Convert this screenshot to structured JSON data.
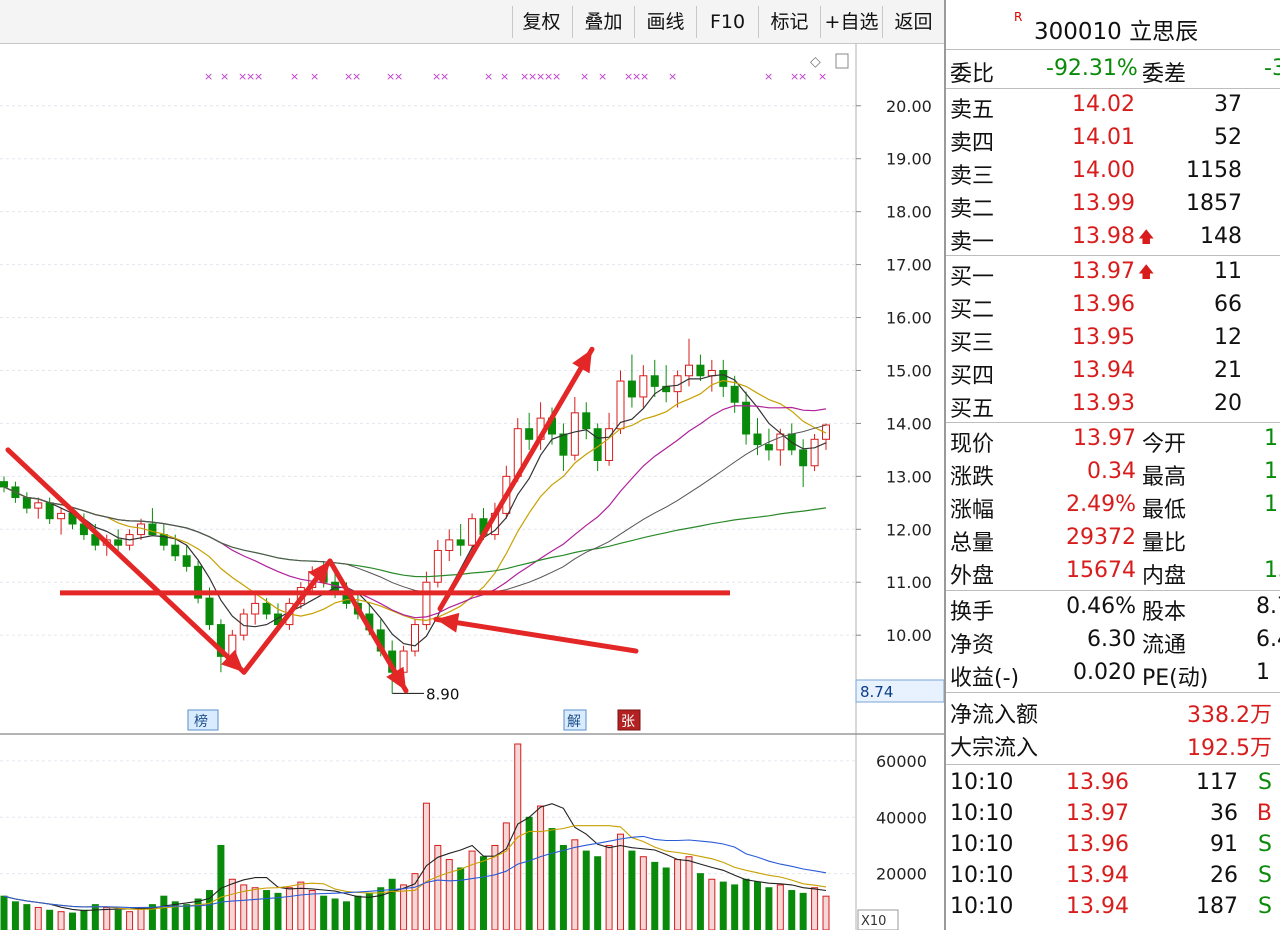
{
  "toolbar": {
    "buttons": [
      "复权",
      "叠加",
      "画线",
      "F10",
      "标记",
      "+自选",
      "返回"
    ]
  },
  "stock": {
    "r_mark": "R",
    "code_name": "300010 立思辰"
  },
  "weibi": {
    "label": "委比",
    "value": "-92.31%",
    "label2": "委差",
    "value2": "-3"
  },
  "sell": [
    {
      "label": "卖五",
      "price": "14.02",
      "vol": "37"
    },
    {
      "label": "卖四",
      "price": "14.01",
      "vol": "52"
    },
    {
      "label": "卖三",
      "price": "14.00",
      "vol": "1158"
    },
    {
      "label": "卖二",
      "price": "13.99",
      "vol": "1857"
    },
    {
      "label": "卖一",
      "price": "13.98",
      "vol": "148"
    }
  ],
  "buy": [
    {
      "label": "买一",
      "price": "13.97",
      "vol": "11"
    },
    {
      "label": "买二",
      "price": "13.96",
      "vol": "66"
    },
    {
      "label": "买三",
      "price": "13.95",
      "vol": "12"
    },
    {
      "label": "买四",
      "price": "13.94",
      "vol": "21"
    },
    {
      "label": "买五",
      "price": "13.93",
      "vol": "20"
    }
  ],
  "quote": [
    {
      "l1": "现价",
      "v1": "13.97",
      "l2": "今开",
      "v2": "1"
    },
    {
      "l1": "涨跌",
      "v1": "0.34",
      "l2": "最高",
      "v2": "1"
    },
    {
      "l1": "涨幅",
      "v1": "2.49%",
      "l2": "最低",
      "v2": "1"
    },
    {
      "l1": "总量",
      "v1": "29372",
      "l2": "量比",
      "v2": ""
    },
    {
      "l1": "外盘",
      "v1": "15674",
      "l2": "内盘",
      "v2": "13"
    }
  ],
  "fund": [
    {
      "l1": "换手",
      "v1": "0.46%",
      "l2": "股本",
      "v2": "8.7"
    },
    {
      "l1": "净资",
      "v1": "6.30",
      "l2": "流通",
      "v2": "6.4"
    },
    {
      "l1": "收益(-)",
      "v1": "0.020",
      "l2": "PE(动)",
      "v2": "1"
    }
  ],
  "flow": [
    {
      "label": "净流入额",
      "value": "338.2万"
    },
    {
      "label": "大宗流入",
      "value": "192.5万"
    }
  ],
  "ticks": [
    {
      "time": "10:10",
      "price": "13.96",
      "vol": "117",
      "side": "S"
    },
    {
      "time": "10:10",
      "price": "13.97",
      "vol": "36",
      "side": "B"
    },
    {
      "time": "10:10",
      "price": "13.96",
      "vol": "91",
      "side": "S"
    },
    {
      "time": "10:10",
      "price": "13.94",
      "vol": "26",
      "side": "S"
    },
    {
      "time": "10:10",
      "price": "13.94",
      "vol": "187",
      "side": "S"
    }
  ],
  "chart_data": {
    "type": "candlestick",
    "price_axis": {
      "ticks": [
        "20.00",
        "19.00",
        "18.00",
        "17.00",
        "16.00",
        "15.00",
        "14.00",
        "13.00",
        "12.00",
        "11.00",
        "10.00"
      ],
      "ylim": [
        8.7,
        20.6
      ]
    },
    "current_price_label": "8.74",
    "low_annotation": {
      "value": 8.9,
      "label": "8.90"
    },
    "candles": [
      [
        12.9,
        13.0,
        12.7,
        12.8
      ],
      [
        12.8,
        12.9,
        12.5,
        12.6
      ],
      [
        12.6,
        12.7,
        12.3,
        12.4
      ],
      [
        12.4,
        12.6,
        12.2,
        12.5
      ],
      [
        12.5,
        12.6,
        12.1,
        12.2
      ],
      [
        12.2,
        12.4,
        11.9,
        12.3
      ],
      [
        12.3,
        12.4,
        12.0,
        12.1
      ],
      [
        12.1,
        12.3,
        11.8,
        11.9
      ],
      [
        11.9,
        12.1,
        11.6,
        11.7
      ],
      [
        11.7,
        11.9,
        11.5,
        11.8
      ],
      [
        11.8,
        12.0,
        11.6,
        11.7
      ],
      [
        11.7,
        12.0,
        11.6,
        11.9
      ],
      [
        11.9,
        12.2,
        11.8,
        12.1
      ],
      [
        12.1,
        12.4,
        11.9,
        11.9
      ],
      [
        11.9,
        12.1,
        11.6,
        11.7
      ],
      [
        11.7,
        11.9,
        11.4,
        11.5
      ],
      [
        11.5,
        11.7,
        11.2,
        11.3
      ],
      [
        11.3,
        11.4,
        10.6,
        10.7
      ],
      [
        10.7,
        10.9,
        10.1,
        10.2
      ],
      [
        10.2,
        10.3,
        9.3,
        9.6
      ],
      [
        9.6,
        10.1,
        9.5,
        10.0
      ],
      [
        10.0,
        10.5,
        9.9,
        10.4
      ],
      [
        10.4,
        10.8,
        10.2,
        10.6
      ],
      [
        10.6,
        10.7,
        10.3,
        10.4
      ],
      [
        10.4,
        10.6,
        10.1,
        10.2
      ],
      [
        10.2,
        10.7,
        10.1,
        10.6
      ],
      [
        10.6,
        11.0,
        10.5,
        10.9
      ],
      [
        10.9,
        11.3,
        10.8,
        11.2
      ],
      [
        11.2,
        11.4,
        10.9,
        11.0
      ],
      [
        11.0,
        11.2,
        10.7,
        10.8
      ],
      [
        10.8,
        11.0,
        10.5,
        10.6
      ],
      [
        10.6,
        10.8,
        10.3,
        10.4
      ],
      [
        10.4,
        10.6,
        10.0,
        10.1
      ],
      [
        10.1,
        10.3,
        9.6,
        9.7
      ],
      [
        9.7,
        9.9,
        8.9,
        9.3
      ],
      [
        9.3,
        9.8,
        9.2,
        9.7
      ],
      [
        9.7,
        10.3,
        9.6,
        10.2
      ],
      [
        10.2,
        11.2,
        10.1,
        11.0
      ],
      [
        11.0,
        11.8,
        10.9,
        11.6
      ],
      [
        11.6,
        12.0,
        11.4,
        11.8
      ],
      [
        11.8,
        12.1,
        11.5,
        11.7
      ],
      [
        11.7,
        12.3,
        11.6,
        12.2
      ],
      [
        12.2,
        12.4,
        11.8,
        11.9
      ],
      [
        11.9,
        12.5,
        11.8,
        12.3
      ],
      [
        12.3,
        13.2,
        12.2,
        13.0
      ],
      [
        13.0,
        14.1,
        12.9,
        13.9
      ],
      [
        13.9,
        14.2,
        13.5,
        13.7
      ],
      [
        13.7,
        14.4,
        13.5,
        14.1
      ],
      [
        14.1,
        14.3,
        13.6,
        13.8
      ],
      [
        13.8,
        14.0,
        13.1,
        13.4
      ],
      [
        13.4,
        14.5,
        13.3,
        14.2
      ],
      [
        14.2,
        14.4,
        13.7,
        13.9
      ],
      [
        13.9,
        14.0,
        13.1,
        13.3
      ],
      [
        13.3,
        14.2,
        13.2,
        13.9
      ],
      [
        13.9,
        15.0,
        13.8,
        14.8
      ],
      [
        14.8,
        15.3,
        14.3,
        14.5
      ],
      [
        14.5,
        15.1,
        14.3,
        14.9
      ],
      [
        14.9,
        15.2,
        14.5,
        14.7
      ],
      [
        14.7,
        15.1,
        14.4,
        14.6
      ],
      [
        14.6,
        15.0,
        14.3,
        14.9
      ],
      [
        14.9,
        15.6,
        14.7,
        15.1
      ],
      [
        15.1,
        15.3,
        14.8,
        14.9
      ],
      [
        14.9,
        15.2,
        14.6,
        15.0
      ],
      [
        15.0,
        15.2,
        14.5,
        14.7
      ],
      [
        14.7,
        14.9,
        14.2,
        14.4
      ],
      [
        14.4,
        14.6,
        13.6,
        13.8
      ],
      [
        13.8,
        14.1,
        13.4,
        13.6
      ],
      [
        13.6,
        13.9,
        13.3,
        13.5
      ],
      [
        13.5,
        13.9,
        13.2,
        13.8
      ],
      [
        13.8,
        14.0,
        13.4,
        13.5
      ],
      [
        13.5,
        13.7,
        12.8,
        13.2
      ],
      [
        13.2,
        13.8,
        13.1,
        13.7
      ],
      [
        13.7,
        14.0,
        13.5,
        13.97
      ]
    ],
    "annotations": {
      "resistance_line_price": 10.8,
      "buy_marker_x": "×××××××××"
    },
    "volume_axis": {
      "ticks": [
        "60000",
        "40000",
        "20000"
      ],
      "ylim": [
        0,
        66000
      ],
      "unit_label": "X10"
    },
    "volumes": [
      12000,
      10000,
      9000,
      8000,
      7000,
      6500,
      6000,
      7000,
      9000,
      8000,
      7000,
      6500,
      8000,
      9000,
      12000,
      10000,
      9000,
      11000,
      14000,
      30000,
      18000,
      16000,
      15000,
      14000,
      13000,
      15000,
      17000,
      14000,
      12000,
      11000,
      10000,
      12000,
      13000,
      15000,
      18000,
      16000,
      20000,
      45000,
      30000,
      25000,
      22000,
      28000,
      26000,
      30000,
      38000,
      66000,
      40000,
      44000,
      36000,
      30000,
      32000,
      28000,
      26000,
      30000,
      34000,
      28000,
      26000,
      24000,
      22000,
      25000,
      26000,
      20000,
      18000,
      17000,
      16000,
      18000,
      17000,
      15000,
      16000,
      14000,
      13000,
      15000,
      12000
    ]
  },
  "chart_labels": {
    "box1": "榜",
    "box2": "解",
    "box3": "张"
  },
  "colors": {
    "up": "#d81c1c",
    "down": "#0a8a0a",
    "annotation": "#e32626"
  }
}
